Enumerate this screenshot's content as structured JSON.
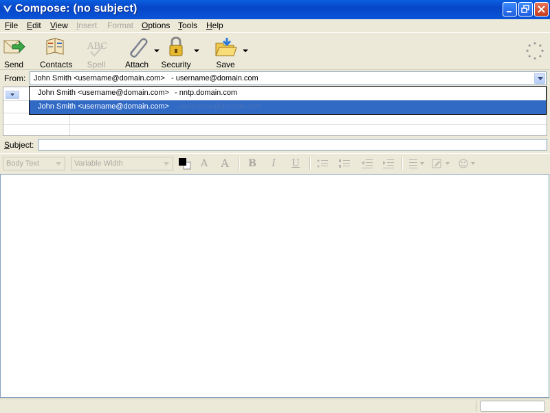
{
  "window": {
    "title": "Compose: (no subject)"
  },
  "menu": [
    {
      "label": "File",
      "u": "F",
      "rest": "ile",
      "disabled": false
    },
    {
      "label": "Edit",
      "u": "E",
      "rest": "dit",
      "disabled": false
    },
    {
      "label": "View",
      "u": "V",
      "rest": "iew",
      "disabled": false
    },
    {
      "label": "Insert",
      "u": "I",
      "rest": "nsert",
      "disabled": true
    },
    {
      "label": "Format",
      "u": "",
      "rest": "Format",
      "disabled": true
    },
    {
      "label": "Options",
      "u": "O",
      "rest": "ptions",
      "disabled": false
    },
    {
      "label": "Tools",
      "u": "T",
      "rest": "ools",
      "disabled": false
    },
    {
      "label": "Help",
      "u": "H",
      "rest": "elp",
      "disabled": false
    }
  ],
  "toolbar": {
    "send": "Send",
    "contacts": "Contacts",
    "spell": "Spell",
    "attach": "Attach",
    "security": "Security",
    "save": "Save"
  },
  "from": {
    "label": "From:",
    "name": "John Smith <username@domain.com>",
    "account": "- username@domain.com",
    "options": [
      {
        "name": "John Smith <username@domain.com>",
        "account": "- nntp.domain.com"
      },
      {
        "name": "John Smith <username@domain.com>",
        "account": "- username@domain.com"
      }
    ]
  },
  "subject": {
    "label": "Subject:",
    "value": ""
  },
  "format": {
    "paragraph_style": "Body Text",
    "font": "Variable Width"
  },
  "colors": {
    "accent": "#316ac5",
    "titlebar": "#0a54d8",
    "disabled_text": "#a9a7a0"
  }
}
